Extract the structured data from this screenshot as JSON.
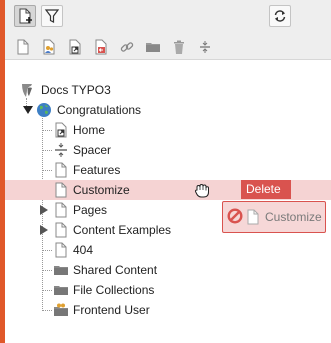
{
  "toolbar": {
    "top_buttons": [
      {
        "name": "new-page-button",
        "icon": "new-page-icon"
      },
      {
        "name": "filter-button",
        "icon": "filter-icon"
      },
      {
        "name": "refresh-button",
        "icon": "refresh-icon"
      }
    ],
    "page_types": [
      "standard-page-icon",
      "backend-user-section-icon",
      "shortcut-page-icon",
      "external-link-page-icon",
      "link-icon",
      "folder-icon",
      "recycler-icon",
      "spacer-icon"
    ]
  },
  "tree": {
    "root": {
      "label": "Docs TYPO3",
      "icon": "typo3-logo-icon"
    },
    "site": {
      "label": "Congratulations",
      "icon": "globe-icon"
    },
    "items": [
      {
        "label": "Home",
        "icon": "shortcut-page-icon",
        "expandable": false
      },
      {
        "label": "Spacer",
        "icon": "spacer-icon",
        "expandable": false
      },
      {
        "label": "Features",
        "icon": "page-icon",
        "expandable": false
      },
      {
        "label": "Customize",
        "icon": "page-icon",
        "expandable": false,
        "selected": true
      },
      {
        "label": "Pages",
        "icon": "page-icon",
        "expandable": true
      },
      {
        "label": "Content Examples",
        "icon": "page-icon",
        "expandable": true
      },
      {
        "label": "404",
        "icon": "page-icon",
        "expandable": false
      },
      {
        "label": "Shared Content",
        "icon": "folder-icon",
        "expandable": false
      },
      {
        "label": "File Collections",
        "icon": "folder-icon",
        "expandable": false
      },
      {
        "label": "Frontend User",
        "icon": "frontend-user-folder-icon",
        "expandable": false
      }
    ]
  },
  "drag": {
    "delete_label": "Delete",
    "drag_label": "Customize",
    "status_icon": "no-drop-icon",
    "cursor_icon": "grab-hand-icon"
  },
  "colors": {
    "accent": "#e0582a",
    "delete": "#d9534f",
    "highlight": "#f5d3d3"
  }
}
